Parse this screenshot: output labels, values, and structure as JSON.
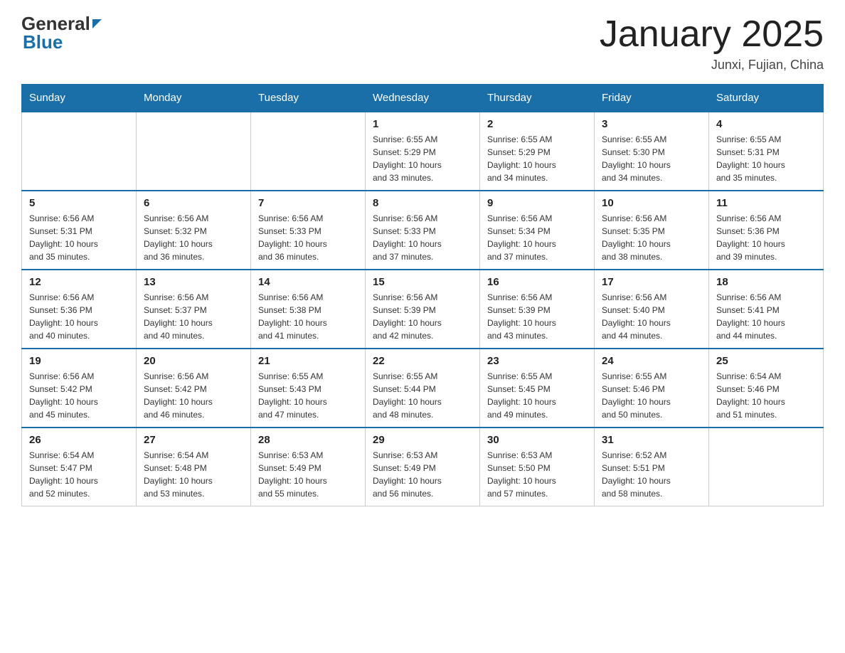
{
  "header": {
    "title": "January 2025",
    "location": "Junxi, Fujian, China",
    "logo_general": "General",
    "logo_blue": "Blue"
  },
  "days_of_week": [
    "Sunday",
    "Monday",
    "Tuesday",
    "Wednesday",
    "Thursday",
    "Friday",
    "Saturday"
  ],
  "weeks": [
    [
      {
        "day": "",
        "info": ""
      },
      {
        "day": "",
        "info": ""
      },
      {
        "day": "",
        "info": ""
      },
      {
        "day": "1",
        "info": "Sunrise: 6:55 AM\nSunset: 5:29 PM\nDaylight: 10 hours\nand 33 minutes."
      },
      {
        "day": "2",
        "info": "Sunrise: 6:55 AM\nSunset: 5:29 PM\nDaylight: 10 hours\nand 34 minutes."
      },
      {
        "day": "3",
        "info": "Sunrise: 6:55 AM\nSunset: 5:30 PM\nDaylight: 10 hours\nand 34 minutes."
      },
      {
        "day": "4",
        "info": "Sunrise: 6:55 AM\nSunset: 5:31 PM\nDaylight: 10 hours\nand 35 minutes."
      }
    ],
    [
      {
        "day": "5",
        "info": "Sunrise: 6:56 AM\nSunset: 5:31 PM\nDaylight: 10 hours\nand 35 minutes."
      },
      {
        "day": "6",
        "info": "Sunrise: 6:56 AM\nSunset: 5:32 PM\nDaylight: 10 hours\nand 36 minutes."
      },
      {
        "day": "7",
        "info": "Sunrise: 6:56 AM\nSunset: 5:33 PM\nDaylight: 10 hours\nand 36 minutes."
      },
      {
        "day": "8",
        "info": "Sunrise: 6:56 AM\nSunset: 5:33 PM\nDaylight: 10 hours\nand 37 minutes."
      },
      {
        "day": "9",
        "info": "Sunrise: 6:56 AM\nSunset: 5:34 PM\nDaylight: 10 hours\nand 37 minutes."
      },
      {
        "day": "10",
        "info": "Sunrise: 6:56 AM\nSunset: 5:35 PM\nDaylight: 10 hours\nand 38 minutes."
      },
      {
        "day": "11",
        "info": "Sunrise: 6:56 AM\nSunset: 5:36 PM\nDaylight: 10 hours\nand 39 minutes."
      }
    ],
    [
      {
        "day": "12",
        "info": "Sunrise: 6:56 AM\nSunset: 5:36 PM\nDaylight: 10 hours\nand 40 minutes."
      },
      {
        "day": "13",
        "info": "Sunrise: 6:56 AM\nSunset: 5:37 PM\nDaylight: 10 hours\nand 40 minutes."
      },
      {
        "day": "14",
        "info": "Sunrise: 6:56 AM\nSunset: 5:38 PM\nDaylight: 10 hours\nand 41 minutes."
      },
      {
        "day": "15",
        "info": "Sunrise: 6:56 AM\nSunset: 5:39 PM\nDaylight: 10 hours\nand 42 minutes."
      },
      {
        "day": "16",
        "info": "Sunrise: 6:56 AM\nSunset: 5:39 PM\nDaylight: 10 hours\nand 43 minutes."
      },
      {
        "day": "17",
        "info": "Sunrise: 6:56 AM\nSunset: 5:40 PM\nDaylight: 10 hours\nand 44 minutes."
      },
      {
        "day": "18",
        "info": "Sunrise: 6:56 AM\nSunset: 5:41 PM\nDaylight: 10 hours\nand 44 minutes."
      }
    ],
    [
      {
        "day": "19",
        "info": "Sunrise: 6:56 AM\nSunset: 5:42 PM\nDaylight: 10 hours\nand 45 minutes."
      },
      {
        "day": "20",
        "info": "Sunrise: 6:56 AM\nSunset: 5:42 PM\nDaylight: 10 hours\nand 46 minutes."
      },
      {
        "day": "21",
        "info": "Sunrise: 6:55 AM\nSunset: 5:43 PM\nDaylight: 10 hours\nand 47 minutes."
      },
      {
        "day": "22",
        "info": "Sunrise: 6:55 AM\nSunset: 5:44 PM\nDaylight: 10 hours\nand 48 minutes."
      },
      {
        "day": "23",
        "info": "Sunrise: 6:55 AM\nSunset: 5:45 PM\nDaylight: 10 hours\nand 49 minutes."
      },
      {
        "day": "24",
        "info": "Sunrise: 6:55 AM\nSunset: 5:46 PM\nDaylight: 10 hours\nand 50 minutes."
      },
      {
        "day": "25",
        "info": "Sunrise: 6:54 AM\nSunset: 5:46 PM\nDaylight: 10 hours\nand 51 minutes."
      }
    ],
    [
      {
        "day": "26",
        "info": "Sunrise: 6:54 AM\nSunset: 5:47 PM\nDaylight: 10 hours\nand 52 minutes."
      },
      {
        "day": "27",
        "info": "Sunrise: 6:54 AM\nSunset: 5:48 PM\nDaylight: 10 hours\nand 53 minutes."
      },
      {
        "day": "28",
        "info": "Sunrise: 6:53 AM\nSunset: 5:49 PM\nDaylight: 10 hours\nand 55 minutes."
      },
      {
        "day": "29",
        "info": "Sunrise: 6:53 AM\nSunset: 5:49 PM\nDaylight: 10 hours\nand 56 minutes."
      },
      {
        "day": "30",
        "info": "Sunrise: 6:53 AM\nSunset: 5:50 PM\nDaylight: 10 hours\nand 57 minutes."
      },
      {
        "day": "31",
        "info": "Sunrise: 6:52 AM\nSunset: 5:51 PM\nDaylight: 10 hours\nand 58 minutes."
      },
      {
        "day": "",
        "info": ""
      }
    ]
  ]
}
